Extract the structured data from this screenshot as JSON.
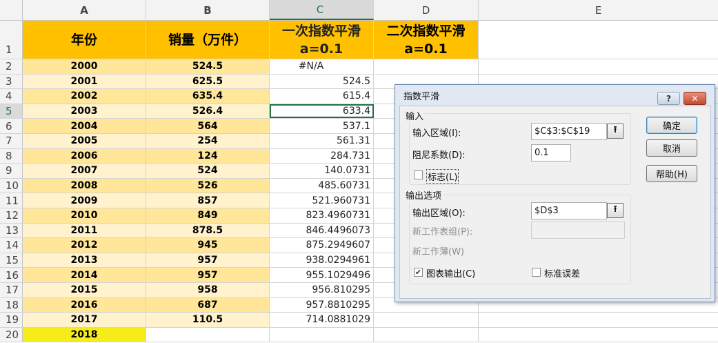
{
  "columns": [
    "A",
    "B",
    "C",
    "D",
    "E"
  ],
  "headers": {
    "year": "年份",
    "sales": "销量（万件）",
    "single_line1": "一次指数平滑",
    "single_line2": "a=0.1",
    "double_line1": "二次指数平滑",
    "double_line2": "a=0.1"
  },
  "rows": [
    {
      "n": "2",
      "year": "2000",
      "sales": "524.5",
      "c": "#N/A"
    },
    {
      "n": "3",
      "year": "2001",
      "sales": "625.5",
      "c": "524.5"
    },
    {
      "n": "4",
      "year": "2002",
      "sales": "635.4",
      "c": "615.4"
    },
    {
      "n": "5",
      "year": "2003",
      "sales": "526.4",
      "c": "633.4"
    },
    {
      "n": "6",
      "year": "2004",
      "sales": "564",
      "c": "537.1"
    },
    {
      "n": "7",
      "year": "2005",
      "sales": "254",
      "c": "561.31"
    },
    {
      "n": "8",
      "year": "2006",
      "sales": "124",
      "c": "284.731"
    },
    {
      "n": "9",
      "year": "2007",
      "sales": "524",
      "c": "140.0731"
    },
    {
      "n": "10",
      "year": "2008",
      "sales": "526",
      "c": "485.60731"
    },
    {
      "n": "11",
      "year": "2009",
      "sales": "857",
      "c": "521.960731"
    },
    {
      "n": "12",
      "year": "2010",
      "sales": "849",
      "c": "823.4960731"
    },
    {
      "n": "13",
      "year": "2011",
      "sales": "878.5",
      "c": "846.4496073"
    },
    {
      "n": "14",
      "year": "2012",
      "sales": "945",
      "c": "875.2949607"
    },
    {
      "n": "15",
      "year": "2013",
      "sales": "957",
      "c": "938.0294961"
    },
    {
      "n": "16",
      "year": "2014",
      "sales": "957",
      "c": "955.1029496"
    },
    {
      "n": "17",
      "year": "2015",
      "sales": "958",
      "c": "956.810295"
    },
    {
      "n": "18",
      "year": "2016",
      "sales": "687",
      "c": "957.8810295"
    },
    {
      "n": "19",
      "year": "2017",
      "sales": "110.5",
      "c": "714.0881029"
    },
    {
      "n": "20",
      "year": "2018",
      "sales": "",
      "c": ""
    }
  ],
  "dialog": {
    "title": "指数平滑",
    "help_icon": "?",
    "close_icon": "✕",
    "input_group": "输入",
    "input_range_label": "输入区域(I):",
    "input_range_value": "$C$3:$C$19",
    "damping_label": "阻尼系数(D):",
    "damping_value": "0.1",
    "labels_label": "标志(L)",
    "labels_checked": false,
    "output_group": "输出选项",
    "output_range_label": "输出区域(O):",
    "output_range_value": "$D$3",
    "new_sheet_label": "新工作表组(P):",
    "new_workbook_label": "新工作薄(W)",
    "chart_output_label": "图表输出(C)",
    "chart_output_checked": true,
    "std_error_label": "标准误差",
    "std_error_checked": false,
    "ok": "确定",
    "cancel": "取消",
    "help": "帮助(H)",
    "ref_icon": "⭱"
  }
}
